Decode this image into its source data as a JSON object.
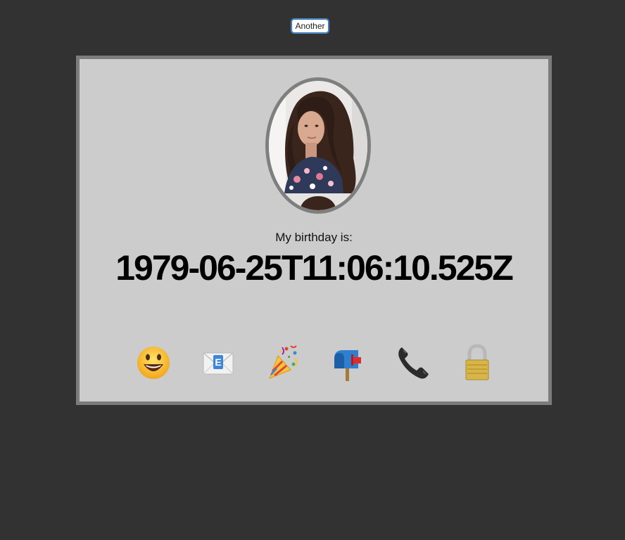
{
  "toolbar": {
    "another_label": "Another"
  },
  "profile": {
    "birthday_label": "My birthday is:",
    "birthday_value": "1979-06-25T11:06:10.525Z",
    "photo_icon": "portrait-photo"
  },
  "actions": [
    {
      "name": "smiley-icon"
    },
    {
      "name": "envelope-icon"
    },
    {
      "name": "party-popper-icon"
    },
    {
      "name": "mailbox-icon"
    },
    {
      "name": "telephone-icon"
    },
    {
      "name": "padlock-icon"
    }
  ],
  "colors": {
    "page_background": "#323232",
    "card_background": "#cccccc",
    "card_border": "#7c7c7c",
    "button_border": "#2c6fb2"
  }
}
